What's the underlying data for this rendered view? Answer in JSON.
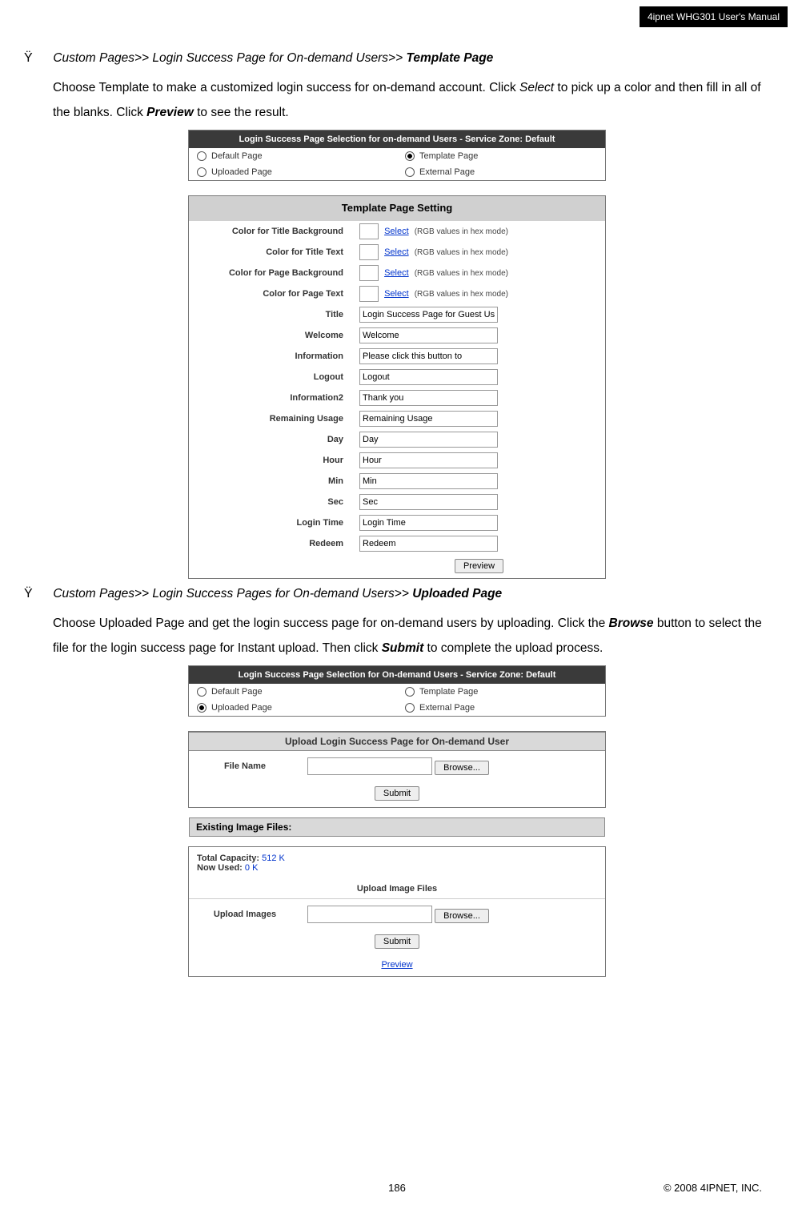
{
  "header": {
    "title": "4ipnet WHG301 User's Manual"
  },
  "section1": {
    "bullet": "Ÿ",
    "breadcrumb_prefix": "Custom Pages>> Login Success Page for On-demand Users>> ",
    "breadcrumb_emph": "Template Page",
    "para_a": "Choose Template to make a customized login success for on-demand account. Click ",
    "select_word": "Select",
    "para_b": " to pick up a color and then fill in all of the blanks. Click ",
    "preview_word": "Preview",
    "para_c": " to see the result."
  },
  "fig1": {
    "panelA_title": "Login Success Page Selection for on-demand Users - Service Zone: Default",
    "opt_default": "Default Page",
    "opt_uploaded": "Uploaded Page",
    "opt_template": "Template Page",
    "opt_external": "External Page",
    "panelB_title": "Template Page Setting",
    "rows": {
      "r1": {
        "label": "Color for Title Background",
        "hex": "(RGB values in hex mode)"
      },
      "r2": {
        "label": "Color for Title Text",
        "hex": "(RGB values in hex mode)"
      },
      "r3": {
        "label": "Color for Page Background",
        "hex": "(RGB values in hex mode)"
      },
      "r4": {
        "label": "Color for Page Text",
        "hex": "(RGB values in hex mode)"
      },
      "r5": {
        "label": "Title",
        "val": "Login Success Page for Guest Users"
      },
      "r6": {
        "label": "Welcome",
        "val": "Welcome"
      },
      "r7": {
        "label": "Information",
        "val": "Please click this button to"
      },
      "r8": {
        "label": "Logout",
        "val": "Logout"
      },
      "r9": {
        "label": "Information2",
        "val": "Thank you"
      },
      "r10": {
        "label": "Remaining Usage",
        "val": "Remaining Usage"
      },
      "r11": {
        "label": "Day",
        "val": "Day"
      },
      "r12": {
        "label": "Hour",
        "val": "Hour"
      },
      "r13": {
        "label": "Min",
        "val": "Min"
      },
      "r14": {
        "label": "Sec",
        "val": "Sec"
      },
      "r15": {
        "label": "Login Time",
        "val": "Login Time"
      },
      "r16": {
        "label": "Redeem",
        "val": "Redeem"
      }
    },
    "select_link": "Select",
    "preview_btn": "Preview"
  },
  "section2": {
    "bullet": "Ÿ",
    "breadcrumb_prefix": "Custom Pages>> Login Success Pages for On-demand Users>> ",
    "breadcrumb_emph": "Uploaded Page",
    "para_a": "Choose Uploaded Page and get the login success page for on-demand users by uploading. Click the ",
    "browse_word": "Browse",
    "para_b": " button to select the file for the login success page for Instant upload. Then click ",
    "submit_word": "Submit",
    "para_c": " to complete the upload process."
  },
  "fig2": {
    "panelA_title": "Login Success Page Selection for On-demand Users - Service Zone: Default",
    "opt_default": "Default Page",
    "opt_uploaded": "Uploaded Page",
    "opt_template": "Template Page",
    "opt_external": "External Page",
    "panelB_title": "Upload Login Success Page for On-demand User",
    "file_name_lbl": "File Name",
    "browse_btn": "Browse...",
    "submit_btn": "Submit",
    "existing": "Existing Image Files:",
    "total_cap_lbl": "Total Capacity: ",
    "total_cap_val": "512 K",
    "now_used_lbl": "Now Used: ",
    "now_used_val": "0 K",
    "upload_img_title": "Upload Image Files",
    "upload_images_lbl": "Upload Images",
    "preview_link": "Preview"
  },
  "footer": {
    "page": "186",
    "copyright": "© 2008 4IPNET, INC."
  }
}
